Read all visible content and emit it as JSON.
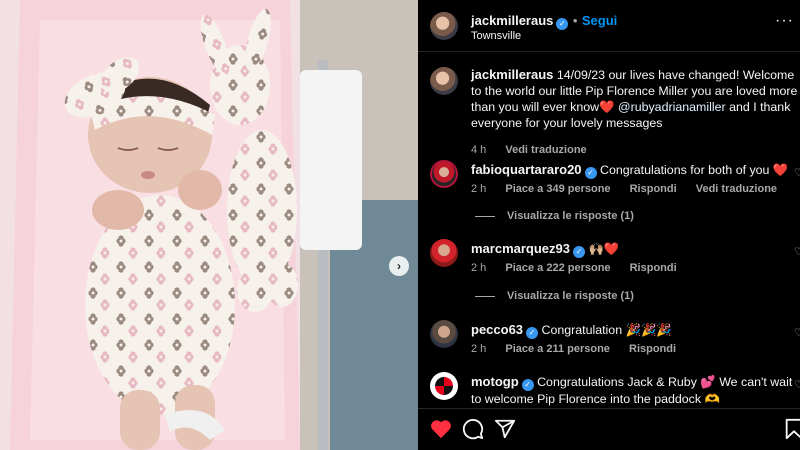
{
  "post": {
    "author": "jackmilleraus",
    "location": "Townsville",
    "follow_label": "Segui",
    "dot": "•",
    "caption": {
      "username": "jackmilleraus",
      "text_1": "14/09/23 our lives have changed! Welcome to the world our little Pip Florence Miller you are loved more than you will ever know",
      "emoji": "❤️",
      "mention": "@rubyadrianamiller",
      "text_2": "and I thank everyone for your lovely messages",
      "time": "4 h",
      "translate": "Vedi traduzione"
    }
  },
  "comments": [
    {
      "username": "fabioquartararo20",
      "text": "Congratulations for both of you ❤️",
      "time": "2 h",
      "likes": "Piace a 349 persone",
      "reply": "Rispondi",
      "translate": "Vedi traduzione",
      "replies": "Visualizza le risposte (1)"
    },
    {
      "username": "marcmarquez93",
      "text": "🙌🏼❤️",
      "time": "2 h",
      "likes": "Piace a 222 persone",
      "reply": "Rispondi",
      "replies": "Visualizza le risposte (1)"
    },
    {
      "username": "pecco63",
      "text": "Congratulation 🎉🎉🎉",
      "time": "2 h",
      "likes": "Piace a 211 persone",
      "reply": "Rispondi"
    },
    {
      "username": "motogp",
      "text": "Congratulations Jack & Ruby 💕 We can't wait to welcome Pip Florence into the paddock 🫶"
    }
  ],
  "icons": {
    "next": "›",
    "more": "···",
    "verified": "✓",
    "heart_outline": "♡"
  },
  "colors": {
    "accent": "#0095f6",
    "like": "#ff3040",
    "verified": "#3897f0"
  }
}
